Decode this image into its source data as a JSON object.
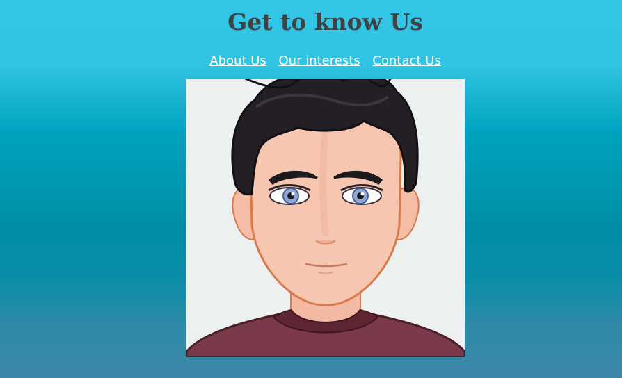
{
  "header": {
    "title": "Get to know Us"
  },
  "nav": {
    "links": [
      {
        "label": "About Us"
      },
      {
        "label": "Our interests"
      },
      {
        "label": "Contact Us"
      }
    ]
  },
  "main": {
    "image": {
      "alt": "cartoon avatar of a young man with dark hair"
    }
  },
  "colors": {
    "gradient_top": "#33c6e6",
    "gradient_middle": "#008ea6",
    "gradient_bottom": "#3d87a8",
    "title_text": "#3d4345",
    "nav_link": "#ffffff",
    "image_background": "#ecf0ef"
  }
}
